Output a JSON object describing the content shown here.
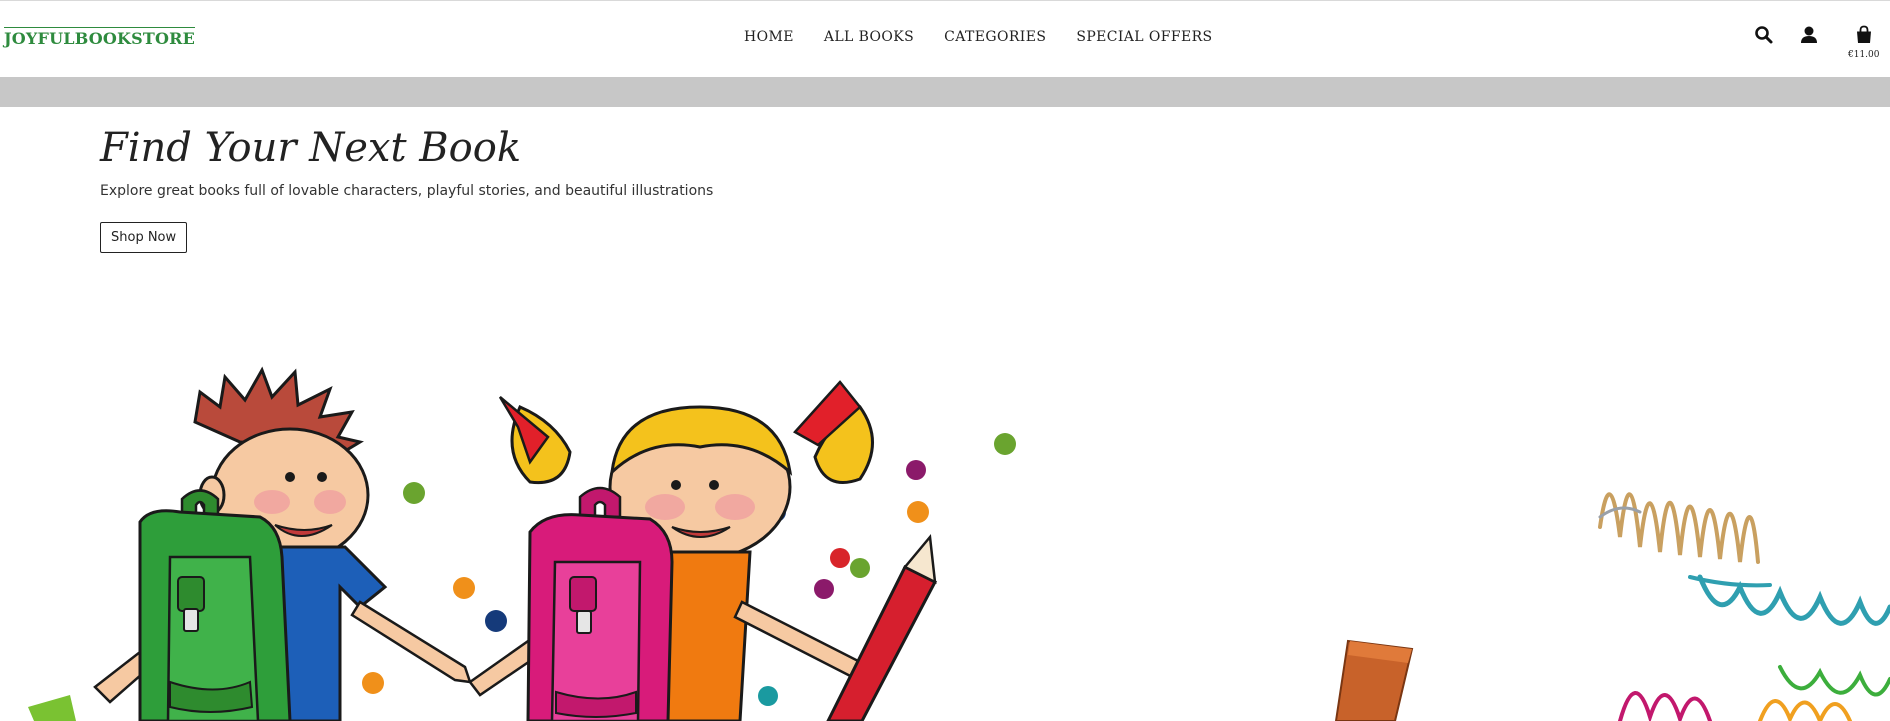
{
  "header": {
    "logo": "JOYFULBOOKSTORE",
    "nav": [
      "HOME",
      "ALL BOOKS",
      "CATEGORIES",
      "SPECIAL OFFERS"
    ],
    "icons": [
      "search-icon",
      "account-icon",
      "shopping-bag-icon"
    ],
    "cart_total": "€11.00"
  },
  "hero": {
    "title": "Find Your Next Book",
    "subtitle": "Explore great books full of lovable characters, playful stories, and beautiful illustrations",
    "cta_label": "Shop Now"
  },
  "colors": {
    "brand": "#2e8b3e",
    "strip": "#c7c7c7",
    "text": "#222222"
  }
}
